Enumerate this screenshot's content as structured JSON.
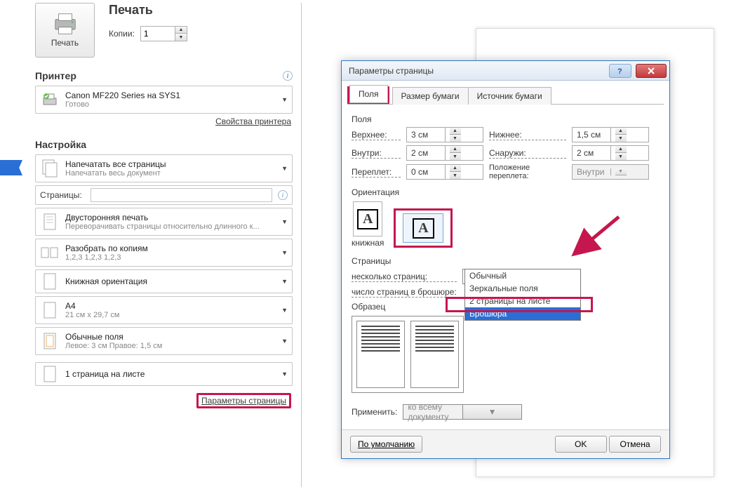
{
  "print": {
    "title": "Печать",
    "button": "Печать",
    "copies_label": "Копии:",
    "copies_value": "1",
    "printer_section": "Принтер",
    "printer_name": "Canon MF220 Series на SYS1",
    "printer_status": "Готово",
    "printer_props": "Свойства принтера",
    "settings_section": "Настройка",
    "items": [
      {
        "title": "Напечатать все страницы",
        "sub": "Напечатать весь документ"
      },
      {
        "title": "Двусторонняя печать",
        "sub": "Переворачивать страницы относительно длинного к..."
      },
      {
        "title": "Разобрать по копиям",
        "sub": "1,2,3   1,2,3   1,2,3"
      },
      {
        "title": "Книжная ориентация",
        "sub": ""
      },
      {
        "title": "A4",
        "sub": "21 см x 29,7 см"
      },
      {
        "title": "Обычные поля",
        "sub": "Левое: 3 см   Правое: 1,5 см"
      },
      {
        "title": "1 страница на листе",
        "sub": ""
      }
    ],
    "pages_label": "Страницы:",
    "page_setup_link": "Параметры страницы"
  },
  "dialog": {
    "title": "Параметры страницы",
    "tabs": [
      "Поля",
      "Размер бумаги",
      "Источник бумаги"
    ],
    "margins_group": "Поля",
    "top_label": "Верхнее:",
    "top_value": "3 см",
    "bottom_label": "Нижнее:",
    "bottom_value": "1,5 см",
    "inside_label": "Внутри:",
    "inside_value": "2 см",
    "outside_label": "Снаружи:",
    "outside_value": "2 см",
    "gutter_label": "Переплет:",
    "gutter_value": "0 см",
    "gutter_pos_label": "Положение переплета:",
    "gutter_pos_value": "Внутри",
    "orient_group": "Ориентация",
    "orient_portrait": "книжная",
    "pages_group": "Страницы",
    "multi_label": "несколько страниц:",
    "multi_value": "Брошюра",
    "multi_options": [
      "Обычный",
      "Зеркальные поля",
      "2 страницы на листе",
      "Брошюра"
    ],
    "sheets_label": "число страниц в брошюре:",
    "preview_group": "Образец",
    "apply_label": "Применить:",
    "apply_value": "ко всему документу",
    "default_btn": "По умолчанию",
    "ok_btn": "OK",
    "cancel_btn": "Отмена"
  }
}
